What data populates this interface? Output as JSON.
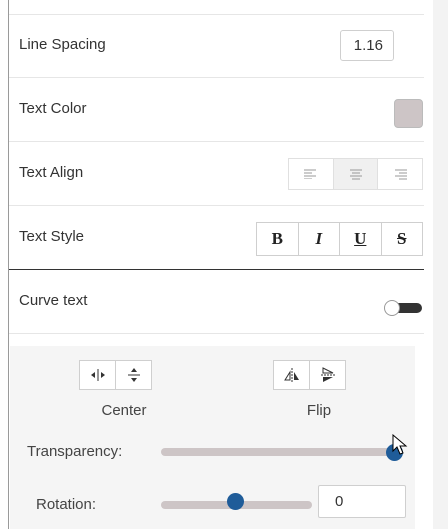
{
  "line_spacing": {
    "label": "Line Spacing",
    "value": "1.16"
  },
  "text_color": {
    "label": "Text Color",
    "color": "#cdc5c6"
  },
  "text_align": {
    "label": "Text Align",
    "options": [
      "left",
      "center",
      "right"
    ],
    "selected": "center"
  },
  "text_style": {
    "label": "Text Style",
    "bold": "B",
    "italic": "I",
    "underline": "U",
    "strike": "S"
  },
  "curve_text": {
    "label": "Curve text",
    "enabled": false
  },
  "position": {
    "center_label": "Center",
    "flip_label": "Flip"
  },
  "transparency": {
    "label": "Transparency:",
    "value_fraction": 1.0
  },
  "rotation": {
    "label": "Rotation:",
    "value": "0",
    "slider_fraction": 0.5
  },
  "colors": {
    "accent": "#1f5c99",
    "track": "#cdc5c6"
  }
}
